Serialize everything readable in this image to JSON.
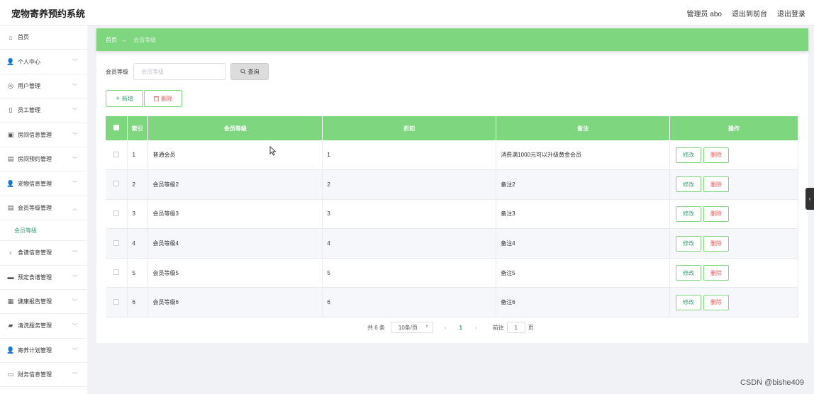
{
  "app": {
    "title": "宠物寄养预约系统"
  },
  "topbar": {
    "user": "管理员 abo",
    "back_front": "退出到前台",
    "logout": "退出登录"
  },
  "sidebar": {
    "items": [
      {
        "label": "首页",
        "icon": "home-icon",
        "chevron": false
      },
      {
        "label": "个人中心",
        "icon": "user-icon",
        "chevron": true
      },
      {
        "label": "用户管理",
        "icon": "globe-icon",
        "chevron": true
      },
      {
        "label": "员工管理",
        "icon": "badge-icon",
        "chevron": true
      },
      {
        "label": "房间信息管理",
        "icon": "image-icon",
        "chevron": true
      },
      {
        "label": "房间预约管理",
        "icon": "clipboard-icon",
        "chevron": true
      },
      {
        "label": "宠物信息管理",
        "icon": "user-icon",
        "chevron": true
      },
      {
        "label": "会员等级管理",
        "icon": "clipboard-icon",
        "chevron": true,
        "expanded": true
      },
      {
        "label": "食谱信息管理",
        "icon": "mic-icon",
        "chevron": true
      },
      {
        "label": "预定食谱管理",
        "icon": "printer-icon",
        "chevron": true
      },
      {
        "label": "健康报告管理",
        "icon": "grid-icon",
        "chevron": true
      },
      {
        "label": "清洗服务管理",
        "icon": "chart-icon",
        "chevron": true
      },
      {
        "label": "寄养计划管理",
        "icon": "user-icon",
        "chevron": true
      },
      {
        "label": "财务信息管理",
        "icon": "bank-icon",
        "chevron": true
      }
    ],
    "sub_active": "会员等级"
  },
  "breadcrumb": {
    "home": "首页",
    "arrow": "→",
    "current": "会员等级"
  },
  "search": {
    "label": "会员等级",
    "placeholder": "会员等级",
    "button": "查询"
  },
  "actions": {
    "add": "新增",
    "delete": "删除"
  },
  "table": {
    "columns": [
      "索引",
      "会员等级",
      "折扣",
      "备注",
      "操作"
    ],
    "rows": [
      {
        "index": "1",
        "level": "普通会员",
        "discount": "1",
        "note": "消费满1000元可以升级黄金会员"
      },
      {
        "index": "2",
        "level": "会员等级2",
        "discount": "2",
        "note": "备注2"
      },
      {
        "index": "3",
        "level": "会员等级3",
        "discount": "3",
        "note": "备注3"
      },
      {
        "index": "4",
        "level": "会员等级4",
        "discount": "4",
        "note": "备注4"
      },
      {
        "index": "5",
        "level": "会员等级5",
        "discount": "5",
        "note": "备注5"
      },
      {
        "index": "6",
        "level": "会员等级6",
        "discount": "6",
        "note": "备注6"
      }
    ],
    "edit_label": "修改",
    "delete_label": "删除"
  },
  "pagination": {
    "total": "共 6 条",
    "page_size": "10条/页",
    "prev": "‹",
    "current": "1",
    "next": "›",
    "goto": "前往",
    "goto_value": "1",
    "page_unit": "页"
  },
  "watermark": "CSDN @bishe409",
  "colors": {
    "accent": "#7ed67f",
    "link_green": "#3a9b72",
    "danger": "#e05a5a"
  }
}
